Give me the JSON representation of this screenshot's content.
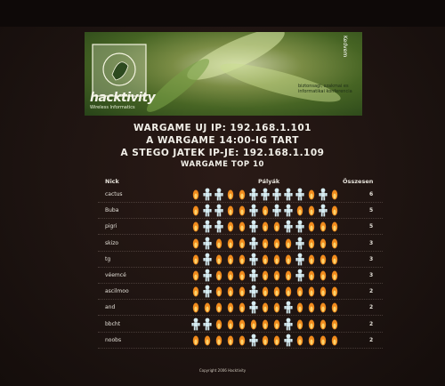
{
  "header": {
    "line1": "WARGAME UJ IP: 192.168.1.101",
    "line2": "A WARGAME 14:00-IG TART",
    "line3": "A STEGO JATEK IP-JE: 192.168.1.109",
    "line4": "WARGAME TOP 10"
  },
  "banner": {
    "logo": "hacktivity",
    "logo_sub": "Wireless Informatics",
    "blurb": "biztonsagi, szakmai es informatikai konferencia",
    "side_label": "Kedvem"
  },
  "table": {
    "col_nick": "Nick",
    "col_levels": "Pályák",
    "col_total": "Összesen",
    "rows": [
      {
        "nick": "cactus",
        "total": "6",
        "levels": [
          0,
          1,
          1,
          0,
          0,
          1,
          1,
          1,
          1,
          1,
          0,
          1,
          0
        ]
      },
      {
        "nick": "Buba",
        "total": "5",
        "levels": [
          0,
          1,
          1,
          0,
          0,
          1,
          0,
          1,
          1,
          0,
          0,
          1,
          0
        ]
      },
      {
        "nick": "pigri",
        "total": "5",
        "levels": [
          0,
          1,
          1,
          0,
          0,
          1,
          0,
          0,
          1,
          1,
          0,
          0,
          0
        ]
      },
      {
        "nick": "skizo",
        "total": "3",
        "levels": [
          0,
          1,
          0,
          0,
          0,
          1,
          0,
          0,
          0,
          1,
          0,
          0,
          0
        ]
      },
      {
        "nick": "tg",
        "total": "3",
        "levels": [
          0,
          1,
          0,
          0,
          0,
          1,
          0,
          0,
          0,
          1,
          0,
          0,
          0
        ]
      },
      {
        "nick": "véemcé",
        "total": "3",
        "levels": [
          0,
          1,
          0,
          0,
          0,
          1,
          0,
          0,
          0,
          1,
          0,
          0,
          0
        ]
      },
      {
        "nick": "ascilmoo",
        "total": "2",
        "levels": [
          0,
          1,
          0,
          0,
          0,
          1,
          0,
          0,
          0,
          0,
          0,
          0,
          0
        ]
      },
      {
        "nick": "and",
        "total": "2",
        "levels": [
          0,
          0,
          0,
          0,
          0,
          1,
          0,
          0,
          1,
          0,
          0,
          0,
          0
        ]
      },
      {
        "nick": "bbcht",
        "total": "2",
        "levels": [
          1,
          1,
          0,
          0,
          0,
          0,
          0,
          0,
          1,
          0,
          0,
          0,
          0
        ]
      },
      {
        "nick": "noobs",
        "total": "2",
        "levels": [
          0,
          0,
          0,
          0,
          0,
          1,
          0,
          0,
          1,
          0,
          0,
          0,
          0
        ]
      }
    ]
  },
  "footer": "Copyright 2006 Hacktivity",
  "colors": {
    "solved": "#d6ecf2",
    "unsolved": "#f08a1c"
  }
}
